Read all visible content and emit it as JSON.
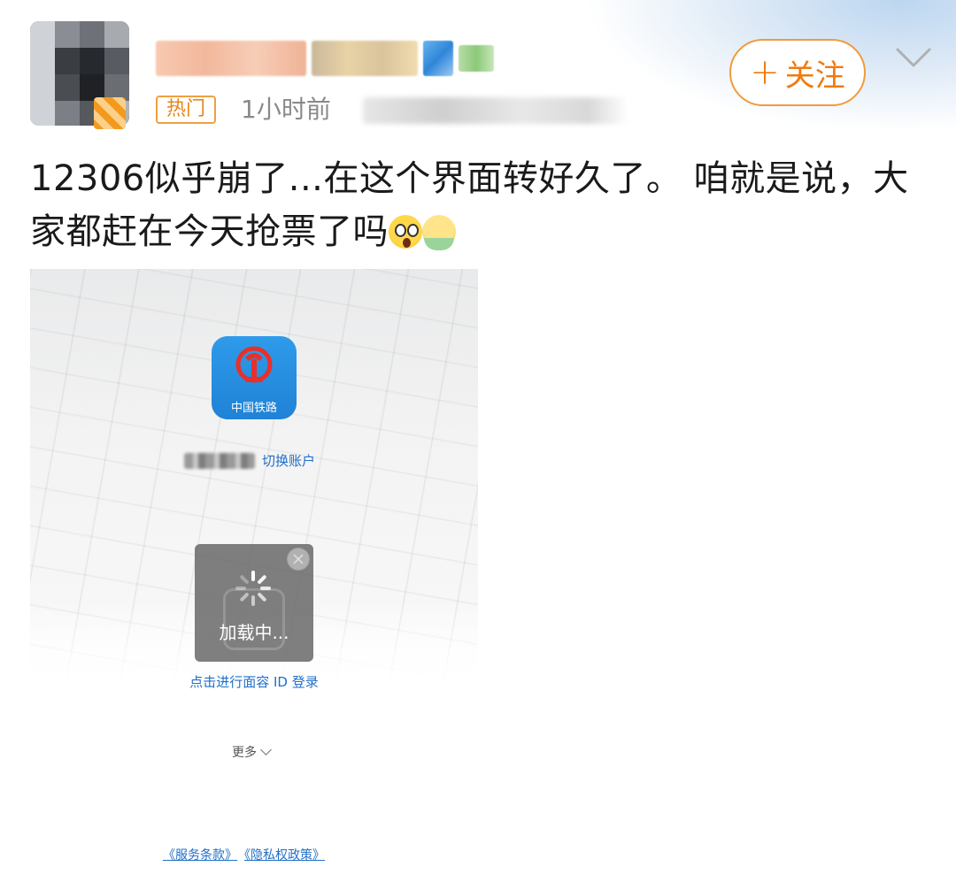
{
  "header": {
    "hot_tag": "热门",
    "time": "1小时前",
    "follow_label": "关注",
    "follow_plus": "+"
  },
  "post": {
    "text": "12306似乎崩了...在这个界面转好久了。 咱就是说，大家都赶在今天抢票了吗",
    "emojis": [
      "shocked-face-emoji",
      "lotus-smile-emoji"
    ],
    "stray_mark": "、"
  },
  "screenshot": {
    "app_name": "中国铁路",
    "switch_account": "切换账户",
    "loading": "加载中...",
    "face_id_login": "点击进行面容 ID 登录",
    "more": "更多",
    "terms": "《服务条款》",
    "privacy": "《隐私权政策》"
  },
  "colors": {
    "accent_orange": "#f07a10",
    "link_blue": "#1f6fc9",
    "app_icon_blue": "#2f9bea",
    "logo_red": "#e8302a"
  }
}
